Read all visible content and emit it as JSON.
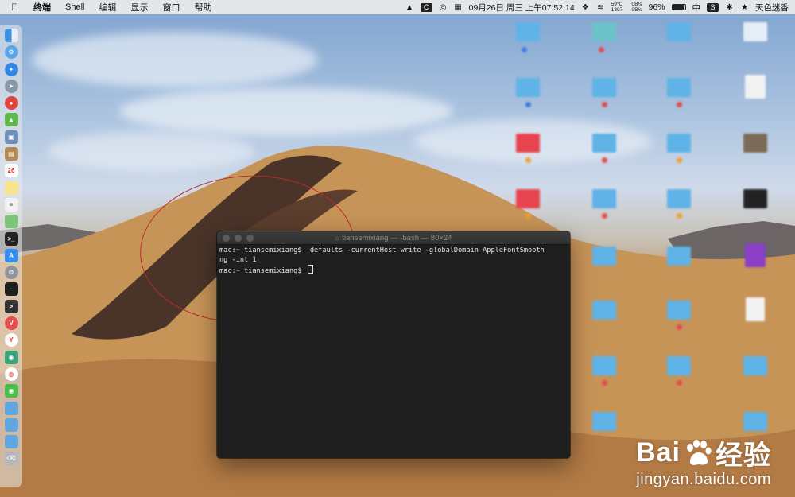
{
  "menubar": {
    "app_name": "终端",
    "menus": [
      "Shell",
      "编辑",
      "显示",
      "窗口",
      "帮助"
    ],
    "status": {
      "temp": "59°C",
      "fan": "1307",
      "net_up": "0B/s",
      "net_down": "0B/s",
      "datetime": "09月26日 周三 上午07:52:14",
      "battery": "96%",
      "input_method": "中",
      "user": "天色迷香"
    }
  },
  "terminal": {
    "title": "tiansemixiang — -bash — 80×24",
    "lines": [
      "mac:~ tiansemixiang$  defaults -currentHost write -globalDomain AppleFontSmooth",
      "ng -int 1",
      "mac:~ tiansemixiang$ "
    ]
  },
  "watermark": {
    "brand_left": "Bai",
    "brand_right": "经验",
    "url": "jingyan.baidu.com"
  },
  "colors": {
    "annotation": "#c0292b",
    "terminal_bg": "#1e1e1e",
    "folder_blue": "#5fb3e6",
    "folder_red": "#e8444f"
  }
}
